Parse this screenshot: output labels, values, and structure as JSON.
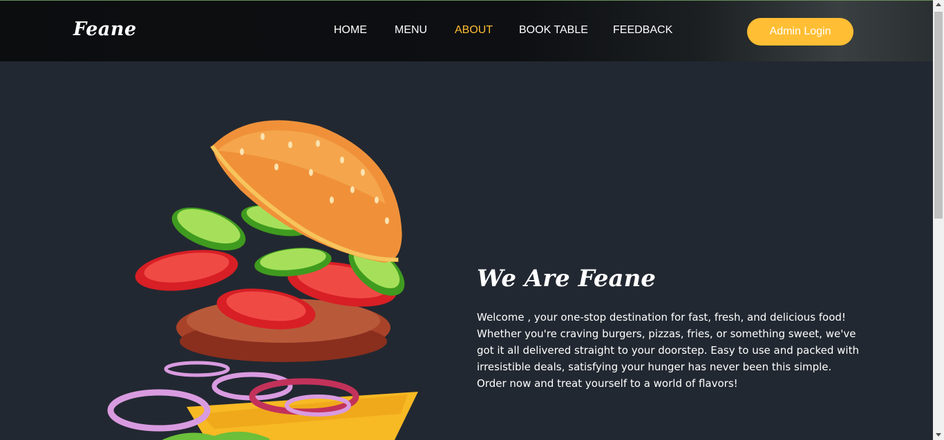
{
  "brand": {
    "name": "Feane"
  },
  "nav": {
    "items": [
      {
        "label": "HOME"
      },
      {
        "label": "MENU"
      },
      {
        "label": "ABOUT"
      },
      {
        "label": "BOOK TABLE"
      },
      {
        "label": "FEEDBACK"
      }
    ],
    "active_index": 2,
    "admin_label": "Admin Login"
  },
  "about": {
    "title": "We Are Feane",
    "text": "Welcome , your one-stop destination for fast, fresh, and delicious food! Whether you're craving burgers, pizzas, fries, or something sweet, we've got it all delivered straight to your doorstep. Easy to use and packed with irresistible deals, satisfying your hunger has never been this simple. Order now and treat yourself to a world of flavors!",
    "image": "exploded-burger-illustration"
  },
  "colors": {
    "background": "#222831",
    "accent": "#ffbe33",
    "text": "#ffffff"
  }
}
